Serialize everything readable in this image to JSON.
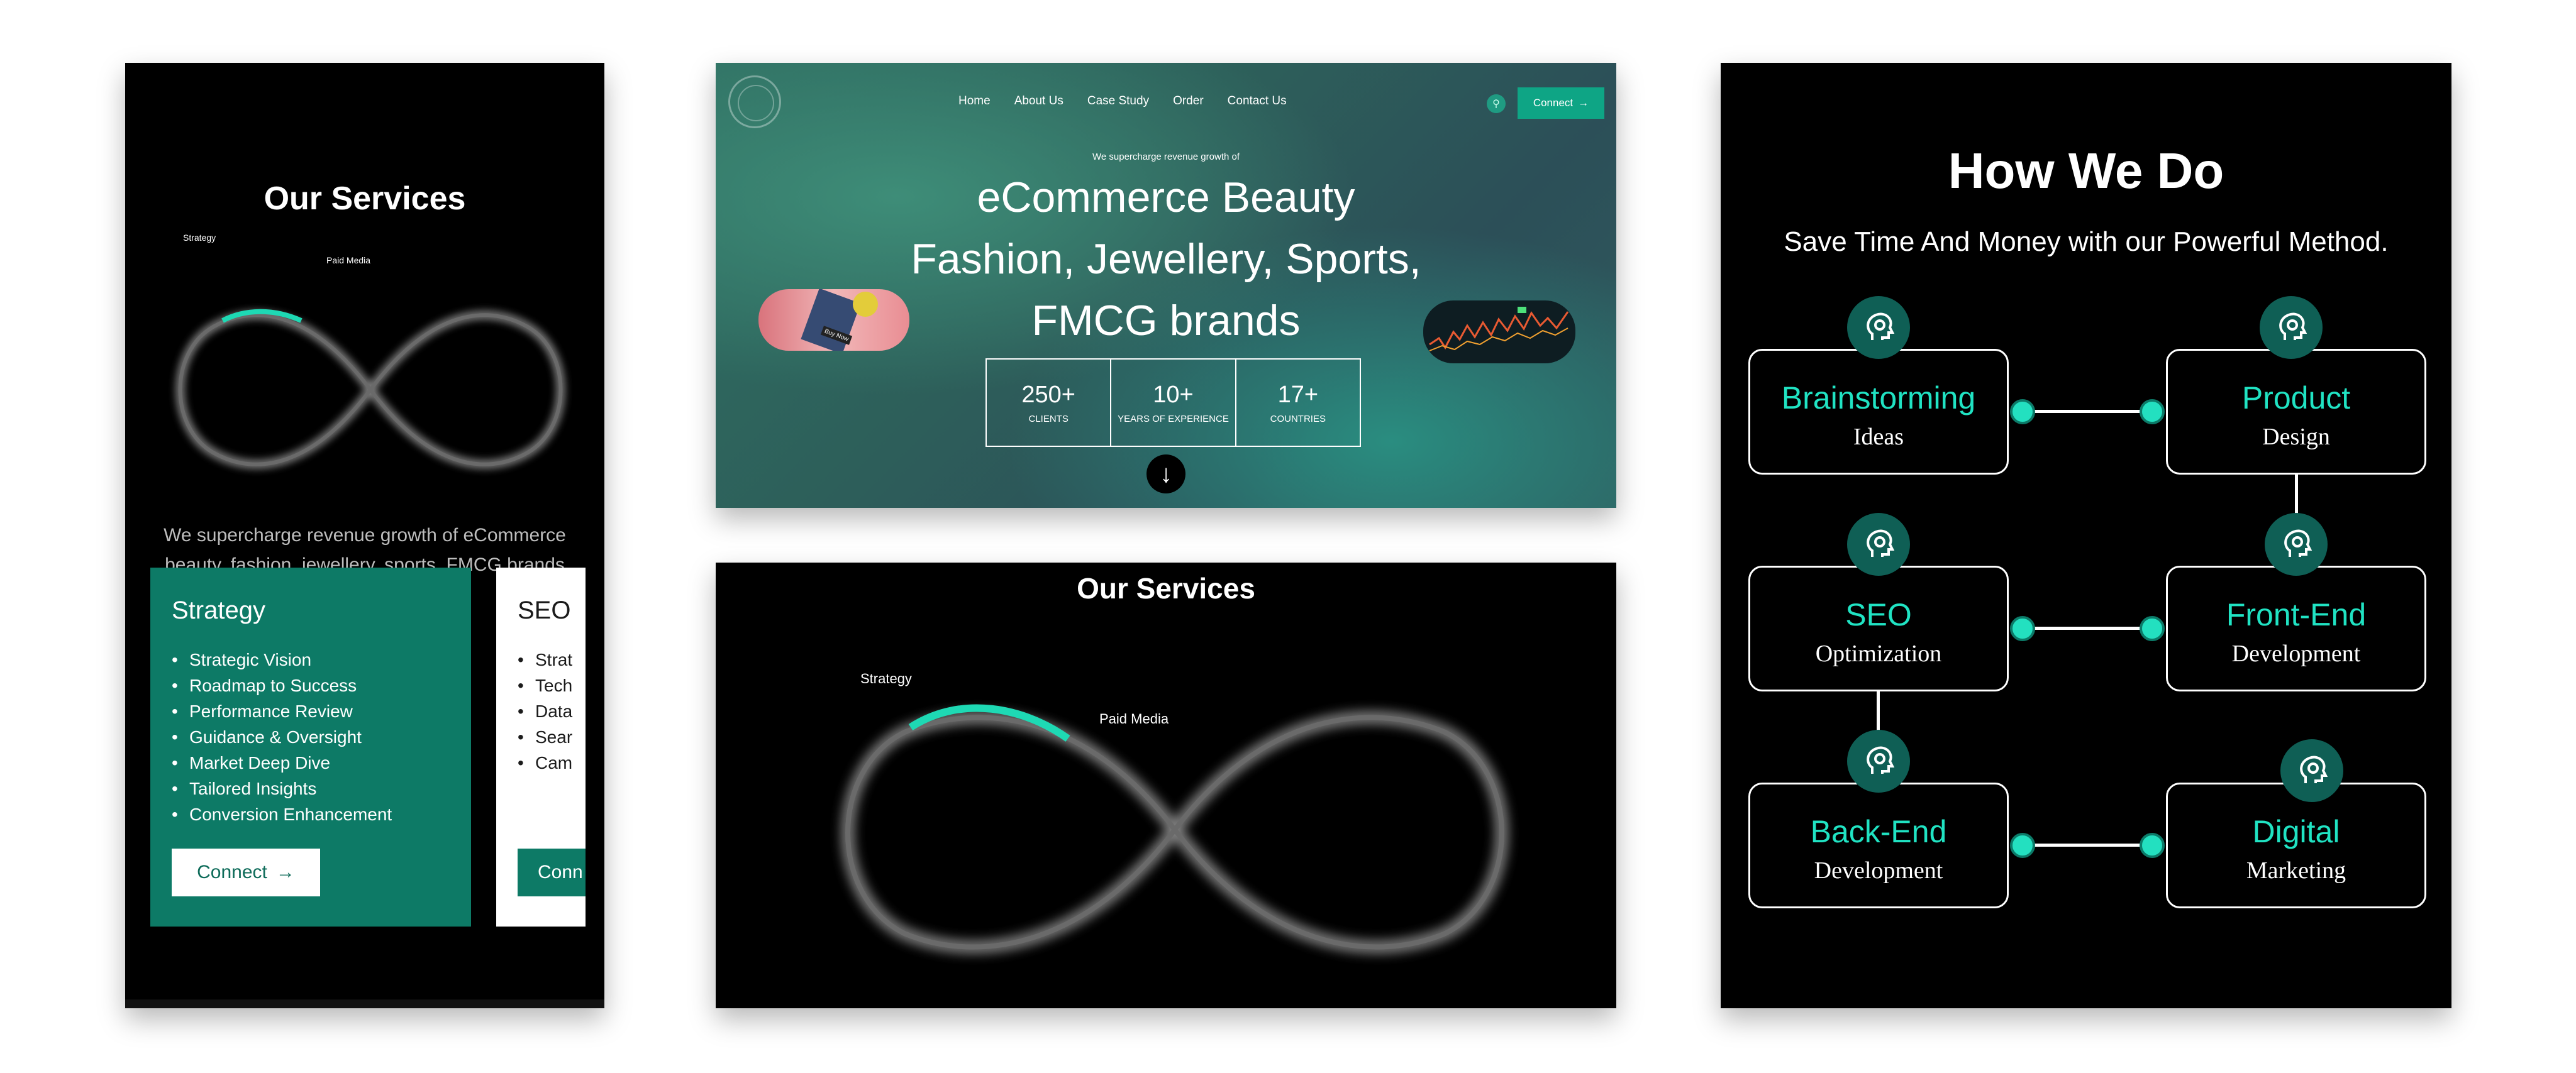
{
  "mobile_services": {
    "title": "Our Services",
    "infinity_labels": {
      "a": "Strategy",
      "b": "Paid Media"
    },
    "description": "We supercharge revenue growth of eCommerce beauty, fashion, jewellery, sports, FMCG brands",
    "cards": [
      {
        "title": "Strategy",
        "items": [
          "Strategic Vision",
          "Roadmap to Success",
          "Performance Review",
          "Guidance & Oversight",
          "Market Deep Dive",
          "Tailored Insights",
          "Conversion Enhancement"
        ],
        "button": "Connect"
      },
      {
        "title": "SEO",
        "items": [
          "Strat",
          "Tech",
          "Data",
          "Sear",
          "Cam"
        ],
        "button": "Conn"
      }
    ]
  },
  "hero": {
    "nav": [
      "Home",
      "About Us",
      "Case Study",
      "Order",
      "Contact Us"
    ],
    "connect": "Connect",
    "kicker": "We supercharge revenue growth of",
    "headline_lines": [
      "eCommerce Beauty",
      "Fashion, Jewellery, Sports,",
      "FMCG brands"
    ],
    "stats": [
      {
        "value": "250+",
        "label": "CLIENTS"
      },
      {
        "value": "10+",
        "label": "YEARS OF EXPERIENCE"
      },
      {
        "value": "17+",
        "label": "COUNTRIES"
      }
    ],
    "pill_left_text": "Buy Now"
  },
  "services_desktop": {
    "title": "Our Services",
    "label_a": "Strategy",
    "label_b": "Paid Media"
  },
  "how_we_do": {
    "title": "How We Do",
    "subtitle": "Save Time And Money with our Powerful Method.",
    "steps": [
      {
        "a": "Brainstorming",
        "b": "Ideas"
      },
      {
        "a": "Product",
        "b": "Design"
      },
      {
        "a": "SEO",
        "b": "Optimization"
      },
      {
        "a": "Front-End",
        "b": "Development"
      },
      {
        "a": "Back-End",
        "b": "Development"
      },
      {
        "a": "Digital",
        "b": "Marketing"
      }
    ]
  },
  "colors": {
    "accent": "#0d7a66",
    "teal_text": "#20e3c3",
    "connect_btn": "#0ea585"
  },
  "icons": [
    "arrow-right-icon",
    "search-icon",
    "arrow-down-icon",
    "head-gear-icon"
  ]
}
